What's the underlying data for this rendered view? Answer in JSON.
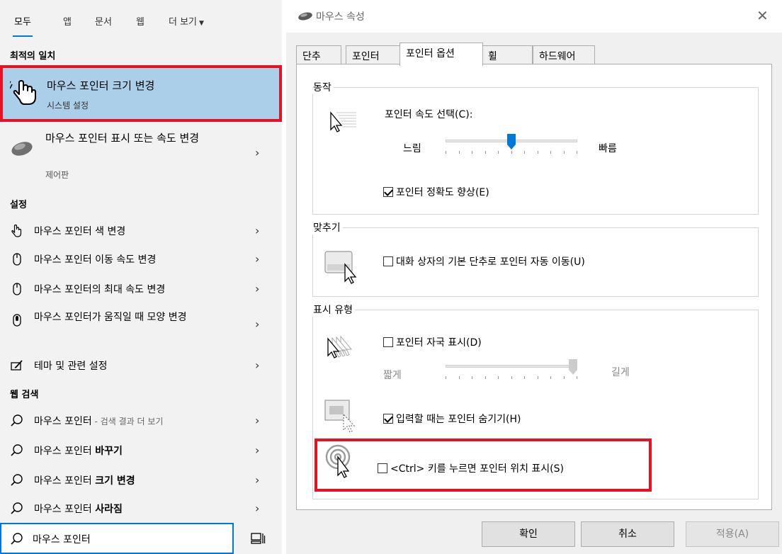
{
  "search": {
    "filters": [
      {
        "label": "모두"
      },
      {
        "label": "앱"
      },
      {
        "label": "문서"
      },
      {
        "label": "웹"
      },
      {
        "label": "더 보기"
      }
    ],
    "best_match_header": "최적의 일치",
    "best_match": {
      "title": "마우스 포인터 크기 변경",
      "subtitle": "시스템 설정"
    },
    "second_result": {
      "title": "마우스 포인터 표시 또는 속도 변경",
      "subtitle": "제어판"
    },
    "settings_header": "설정",
    "settings_items": [
      "마우스 포인터 색 변경",
      "마우스 포인터 이동 속도 변경",
      "마우스 포인터의 최대 속도 변경",
      "마우스 포인터가 움직일 때 모양 변경",
      "테마 및 관련 설정"
    ],
    "web_header": "웹 검색",
    "web_items": [
      {
        "prefix": "마우스 포인터",
        "suffix": " - 검색 결과 더 보기",
        "bold": ""
      },
      {
        "prefix": "마우스 포인터 ",
        "suffix": "",
        "bold": "바꾸기"
      },
      {
        "prefix": "마우스 포인터 ",
        "suffix": "",
        "bold": "크기 변경"
      },
      {
        "prefix": "마우스 포인터 ",
        "suffix": "",
        "bold": "사라짐"
      }
    ],
    "query": "마우스 포인터"
  },
  "dialog": {
    "title": "마우스 속성",
    "tabs": [
      "단추",
      "포인터",
      "포인터 옵션",
      "휠",
      "하드웨어"
    ],
    "active_tab": 2,
    "motion": {
      "legend": "동작",
      "speed_label": "포인터 속도 선택(C):",
      "slow": "느림",
      "fast": "빠름",
      "speed_value": 0.5,
      "precision_label": "포인터 정확도 향상(E)",
      "precision_checked": true
    },
    "snap": {
      "legend": "맞추기",
      "label": "대화 상자의 기본 단추로 포인터 자동 이동(U)",
      "checked": false
    },
    "visibility": {
      "legend": "표시 유형",
      "trails_label": "포인터 자국 표시(D)",
      "trails_checked": false,
      "short": "짧게",
      "long": "길게",
      "trail_value": 1.0,
      "hide_label": "입력할 때는 포인터 숨기기(H)",
      "hide_checked": true,
      "ctrl_label": "<Ctrl> 키를 누르면 포인터 위치 표시(S)",
      "ctrl_checked": false
    },
    "buttons": {
      "ok": "확인",
      "cancel": "취소",
      "apply": "적용(A)"
    }
  },
  "colors": {
    "highlight": "#e81123",
    "accent": "#0078d7",
    "selected_bg": "#abcfe9"
  }
}
